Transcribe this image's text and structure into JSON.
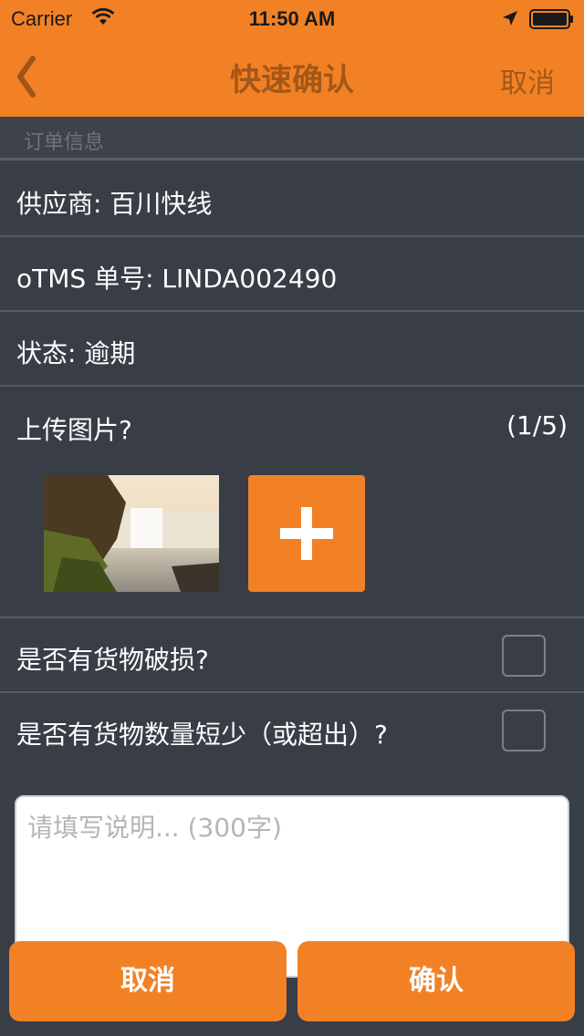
{
  "status_bar": {
    "carrier": "Carrier",
    "time": "11:50 AM",
    "icons": [
      "wifi-icon",
      "location-icon",
      "battery-icon"
    ]
  },
  "nav": {
    "title": "快速确认",
    "cancel_label": "取消",
    "back_icon": "chevron-left-icon"
  },
  "section": {
    "title": "订单信息"
  },
  "rows": [
    {
      "label": "供应商: 百川快线"
    },
    {
      "label": "oTMS 单号: LINDA002490"
    },
    {
      "label": "状态: 逾期"
    }
  ],
  "upload": {
    "label": "上传图片?",
    "count": "(1/5)"
  },
  "checks": [
    {
      "label": "是否有货物破损?",
      "checked": false
    },
    {
      "label": "是否有货物数量短少（或超出）?",
      "checked": false
    }
  ],
  "note": {
    "placeholder": "请填写说明... (300字)",
    "value": ""
  },
  "buttons": {
    "cancel_label": "取消",
    "confirm_label": "确认"
  },
  "colors": {
    "accent": "#f28126",
    "background": "#383d46"
  }
}
